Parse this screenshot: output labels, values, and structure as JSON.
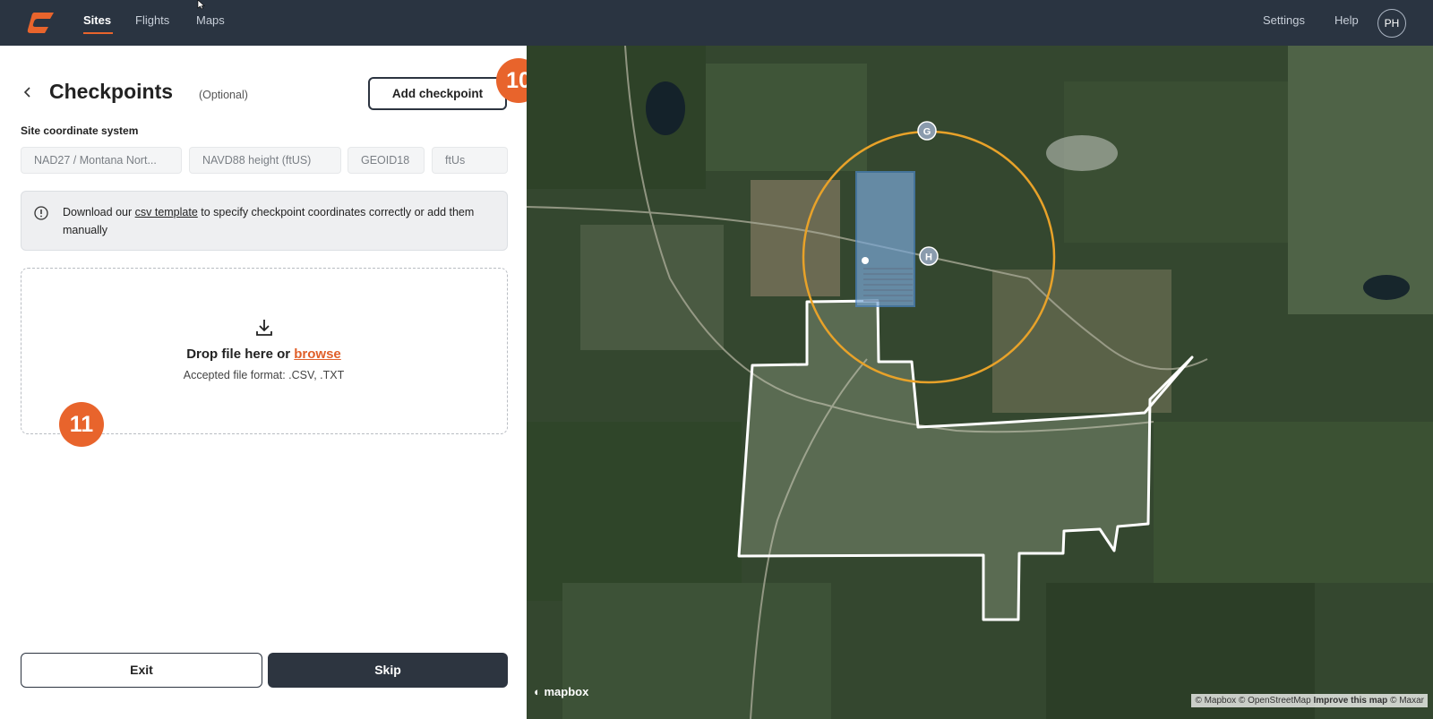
{
  "nav": {
    "links": [
      "Sites",
      "Flights",
      "Maps"
    ],
    "settings": "Settings",
    "help": "Help",
    "avatar": "PH",
    "logo_icon": "brand-logo-icon"
  },
  "panel": {
    "title": "Checkpoints",
    "optional": "(Optional)",
    "add_button": "Add checkpoint",
    "step_badges": [
      "10",
      "11"
    ],
    "coord_label": "Site coordinate system",
    "coord_chips": [
      "NAD27 / Montana Nort...",
      "NAVD88 height (ftUS)",
      "GEOID18",
      "ftUs"
    ],
    "info": {
      "prefix": "Download our",
      "link": "csv template",
      "suffix": "to specify checkpoint coordinates correctly or add them manually"
    },
    "drop": {
      "main": "Drop file here or",
      "browse": "browse",
      "formats": "Accepted file format: .CSV, .TXT"
    },
    "exit_button": "Exit",
    "skip_button": "Skip"
  },
  "map": {
    "markers": [
      "G",
      "H"
    ],
    "logo": "mapbox",
    "attribution": "© Mapbox © OpenStreetMap",
    "improve": "Improve this map",
    "maxar": "© Maxar",
    "colors": {
      "radius_circle": "#e8a229",
      "boundary": "#ffffff",
      "flight_area": "#7aa7d6"
    }
  },
  "colors": {
    "accent": "#e8642c",
    "topbar": "#2a3441",
    "skip_button": "#2d3540"
  }
}
